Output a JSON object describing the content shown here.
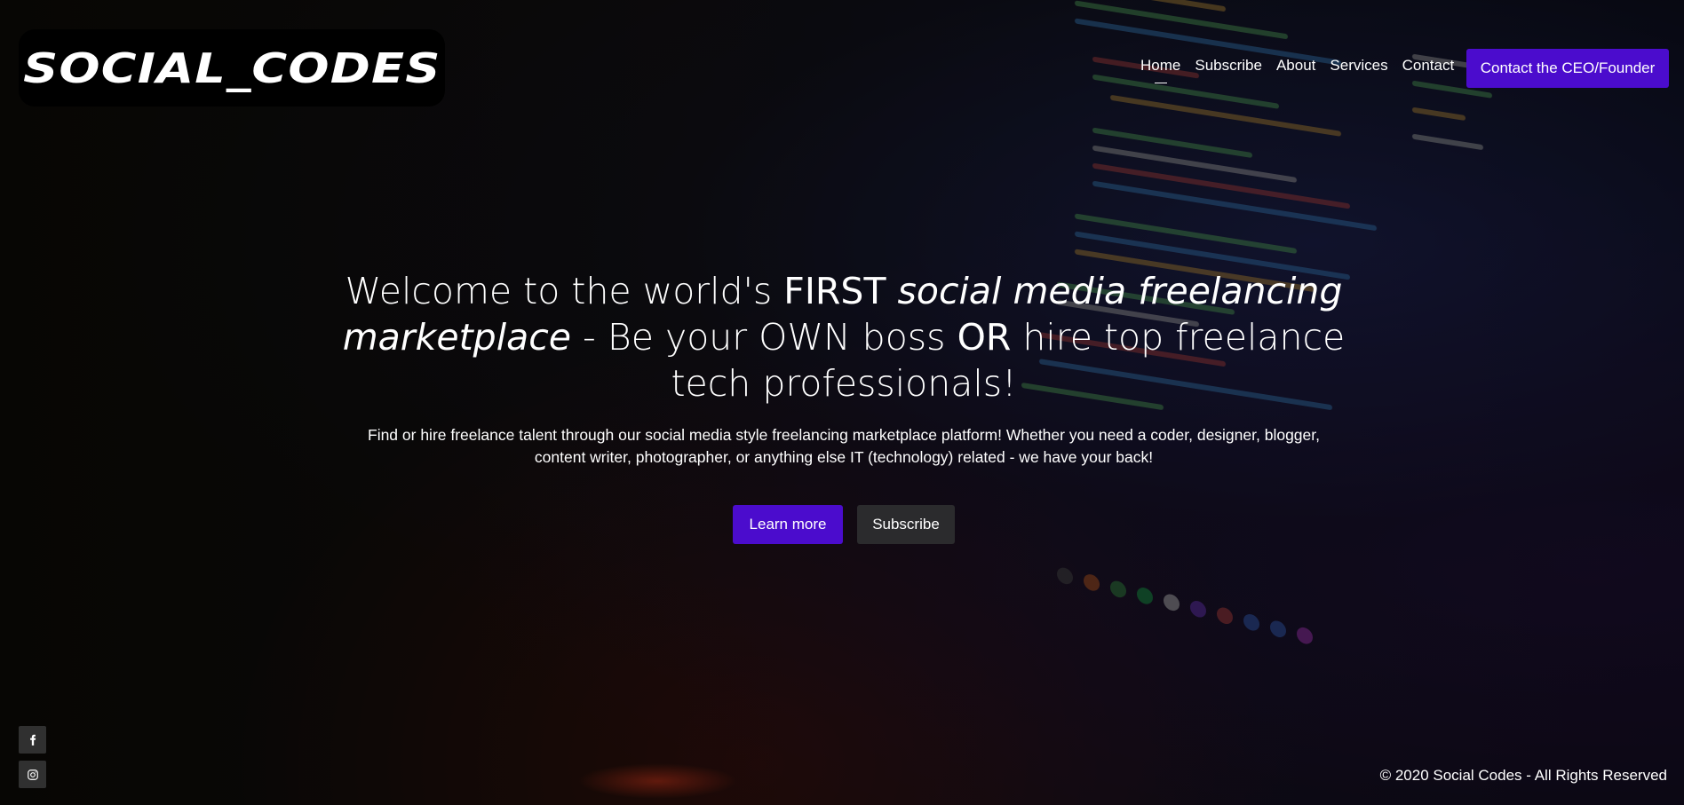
{
  "brand": {
    "logo_text": "SOCIAL_CODES",
    "accent_color": "#4b0ccd",
    "secondary_button_color": "#2b2b2d"
  },
  "nav": {
    "items": [
      {
        "label": "Home",
        "active": true
      },
      {
        "label": "Subscribe",
        "active": false
      },
      {
        "label": "About",
        "active": false
      },
      {
        "label": "Services",
        "active": false
      },
      {
        "label": "Contact",
        "active": false
      }
    ],
    "cta_label": "Contact the CEO/Founder"
  },
  "hero": {
    "title_part1": "Welcome to the world's ",
    "title_first": "FIRST",
    "title_italic": "social media freelancing marketplace",
    "title_part2": " - Be your OWN boss ",
    "title_or": "OR",
    "title_part3": " hire top freelance tech professionals!",
    "subtitle": "Find or hire freelance talent through our social media style freelancing marketplace platform! Whether you need a coder, designer, blogger, content writer, photographer, or anything else IT (technology) related - we have your back!",
    "primary_button": "Learn more",
    "secondary_button": "Subscribe"
  },
  "social": {
    "items": [
      {
        "icon": "facebook-icon"
      },
      {
        "icon": "instagram-icon"
      }
    ]
  },
  "footer": {
    "copyright": "© 2020 Social Codes - All Rights Reserved"
  }
}
